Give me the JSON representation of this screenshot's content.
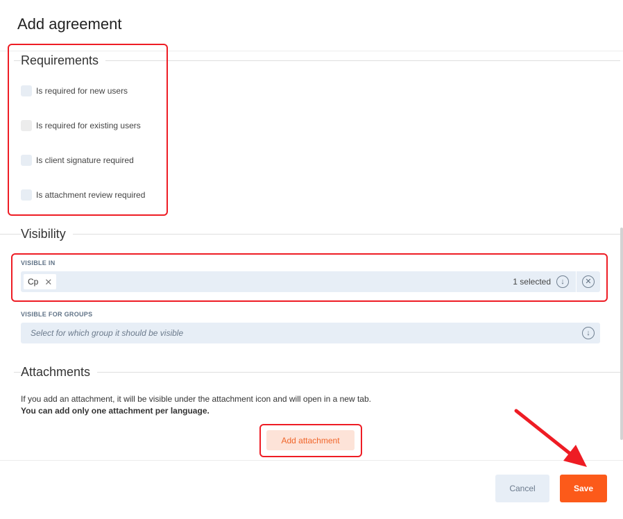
{
  "dialog": {
    "title": "Add agreement"
  },
  "requirements": {
    "heading": "Requirements",
    "items": [
      {
        "label": "Is required for new users",
        "checked": false
      },
      {
        "label": "Is required for existing users",
        "checked": false
      },
      {
        "label": "Is client signature required",
        "checked": false
      },
      {
        "label": "Is attachment review required",
        "checked": false
      }
    ]
  },
  "visibility": {
    "heading": "Visibility",
    "visible_in": {
      "label": "VISIBLE IN",
      "chips": [
        "Cp"
      ],
      "chip_remove_glyph": "✕",
      "selected_count": "1 selected",
      "dropdown_icon": "arrow-down-circle-icon",
      "clear_icon": "clear-circle-icon"
    },
    "visible_for_groups": {
      "label": "VISIBLE FOR GROUPS",
      "placeholder": "Select for which group it should be visible",
      "dropdown_icon": "arrow-down-circle-icon"
    }
  },
  "attachments": {
    "heading": "Attachments",
    "info": "If you add an attachment, it will be visible under the attachment icon and will open in a new tab.",
    "note": "You can add only one attachment per language.",
    "add_button": "Add attachment"
  },
  "footer": {
    "cancel_label": "Cancel",
    "save_label": "Save"
  },
  "colors": {
    "accent": "#fc5a1a",
    "accent_soft": "#fde3d8",
    "field_bg": "#e7eef6",
    "annotation": "#ee1c24"
  }
}
